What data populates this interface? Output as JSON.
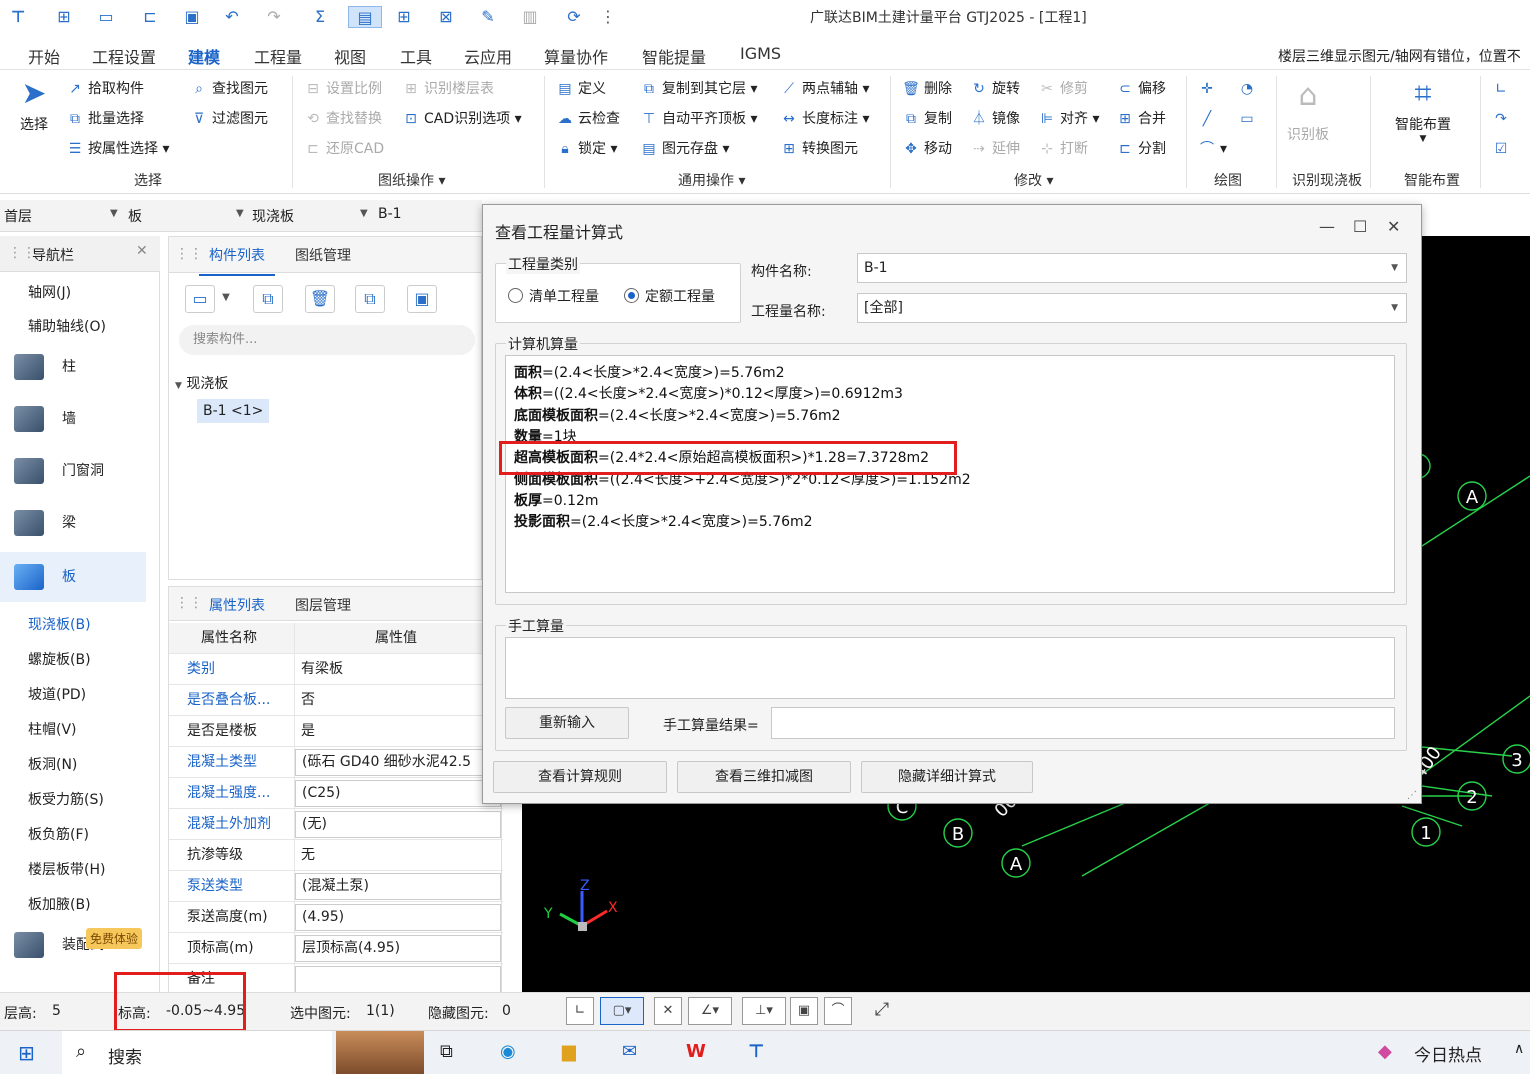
{
  "window": {
    "title": "广联达BIM土建计量平台 GTJ2025 - [工程1]"
  },
  "quick_access": [
    "logo-icon",
    "new-icon",
    "new-file-icon",
    "open-icon",
    "save-icon",
    "undo-icon",
    "redo-icon",
    "sum-icon",
    "quantity-view-icon",
    "table-icon",
    "grid-icon",
    "edit-icon",
    "compare-icon",
    "sync-icon",
    "more-icon"
  ],
  "menu": {
    "tabs": [
      "开始",
      "工程设置",
      "建模",
      "工程量",
      "视图",
      "工具",
      "云应用",
      "算量协作",
      "智能提量",
      "IGMS"
    ],
    "active": "建模",
    "marquee": "楼层三维显示图元/轴网有错位，位置不"
  },
  "ribbon": {
    "select": {
      "big": "选择",
      "items": [
        "拾取构件",
        "批量选择",
        "按属性选择",
        "查找图元",
        "过滤图元"
      ],
      "label": "选择"
    },
    "drawing": {
      "items": [
        "设置比例",
        "识别楼层表",
        "查找替换",
        "CAD识别选项",
        "还原CAD"
      ],
      "label": "图纸操作"
    },
    "general": {
      "items": [
        "定义",
        "复制到其它层",
        "两点辅轴",
        "云检查",
        "自动平齐顶板",
        "长度标注",
        "锁定",
        "图元存盘",
        "转换图元"
      ],
      "label": "通用操作"
    },
    "modify": {
      "items": [
        "删除",
        "旋转",
        "修剪",
        "偏移",
        "复制",
        "镜像",
        "对齐",
        "合并",
        "移动",
        "延伸",
        "打断",
        "分割"
      ],
      "label": "修改"
    },
    "draw": {
      "label": "绘图"
    },
    "recognize": {
      "big": "识别板",
      "label": "识别现浇板"
    },
    "smart": {
      "big": "智能布置",
      "label": "智能布置"
    }
  },
  "layer_row": {
    "floor": "首层",
    "type": "板",
    "subtype": "现浇板",
    "component": "B-1"
  },
  "nav": {
    "title": "导航栏",
    "axis_items": [
      "轴网(J)",
      "辅助轴线(O)"
    ],
    "categories": [
      "柱",
      "墙",
      "门窗洞",
      "梁",
      "板"
    ],
    "active_category": "板",
    "slab_items": [
      "现浇板(B)",
      "螺旋板(B)",
      "坡道(PD)",
      "柱帽(V)",
      "板洞(N)",
      "板受力筋(S)",
      "板负筋(F)",
      "楼层板带(H)",
      "板加腋(B)"
    ],
    "bottom_items": [
      "装配式",
      "免费体验"
    ]
  },
  "component_list": {
    "tabs": [
      "构件列表",
      "图纸管理"
    ],
    "search_placeholder": "搜索构件...",
    "tree_parent": "现浇板",
    "tree_child": "B-1 <1>"
  },
  "properties": {
    "tabs": [
      "属性列表",
      "图层管理"
    ],
    "headers": [
      "属性名称",
      "属性值"
    ],
    "rows": [
      {
        "name": "类别",
        "value": "有梁板"
      },
      {
        "name": "是否叠合板...",
        "value": "否"
      },
      {
        "name": "是否是楼板",
        "value": "是"
      },
      {
        "name": "混凝土类型",
        "value": "(砾石 GD40 细砂水泥42.5"
      },
      {
        "name": "混凝土强度...",
        "value": "(C25)"
      },
      {
        "name": "混凝土外加剂",
        "value": "(无)"
      },
      {
        "name": "抗渗等级",
        "value": "无"
      },
      {
        "name": "泵送类型",
        "value": "(混凝土泵)"
      },
      {
        "name": "泵送高度(m)",
        "value": "(4.95)"
      },
      {
        "name": "顶标高(m)",
        "value": "层顶标高(4.95)"
      },
      {
        "name": "备注",
        "value": ""
      }
    ]
  },
  "dialog": {
    "title": "查看工程量计算式",
    "qty_type_group": "工程量类别",
    "radio_bill": "清单工程量",
    "radio_quota": "定额工程量",
    "component_name_label": "构件名称:",
    "component_name_value": "B-1",
    "qty_name_label": "工程量名称:",
    "qty_name_value": "[全部]",
    "computer_group": "计算机算量",
    "lines": [
      {
        "k": "面积",
        "v": "=(2.4<长度>*2.4<宽度>)=5.76m2"
      },
      {
        "k": "体积",
        "v": "=((2.4<长度>*2.4<宽度>)*0.12<厚度>)=0.6912m3"
      },
      {
        "k": "底面模板面积",
        "v": "=(2.4<长度>*2.4<宽度>)=5.76m2"
      },
      {
        "k": "数量",
        "v": "=1块"
      },
      {
        "k": "超高模板面积",
        "v": "=(2.4*2.4<原始超高模板面积>)*1.28=7.3728m2"
      },
      {
        "k": "侧面模板面积",
        "v": "=((2.4<长度>+2.4<宽度>)*2*0.12<厚度>)=1.152m2"
      },
      {
        "k": "板厚",
        "v": "=0.12m"
      },
      {
        "k": "投影面积",
        "v": "=(2.4<长度>*2.4<宽度>)=5.76m2"
      }
    ],
    "manual_group": "手工算量",
    "reinput_btn": "重新输入",
    "manual_result_label": "手工算量结果=",
    "btn_rules": "查看计算规则",
    "btn_3d": "查看三维扣减图",
    "btn_hide": "隐藏详细计算式"
  },
  "canvas": {
    "axis_labels": [
      "A",
      "A",
      "B",
      "C",
      "1",
      "2",
      "3"
    ],
    "dim_text": [
      "400",
      "00"
    ],
    "xyz": [
      "Z",
      "Y",
      "X"
    ]
  },
  "status": {
    "floor_height_label": "层高:",
    "floor_height": "5",
    "elevation_label": "标高:",
    "elevation": "-0.05~4.95",
    "selected_label": "选中图元:",
    "selected": "1(1)",
    "hidden_label": "隐藏图元:",
    "hidden": "0"
  },
  "taskbar": {
    "search": "搜索",
    "news": "今日热点"
  },
  "colors": {
    "accent": "#1a63c8",
    "highlight": "#e11d1d",
    "canvas": "#000000",
    "axis": "#27d14a"
  }
}
